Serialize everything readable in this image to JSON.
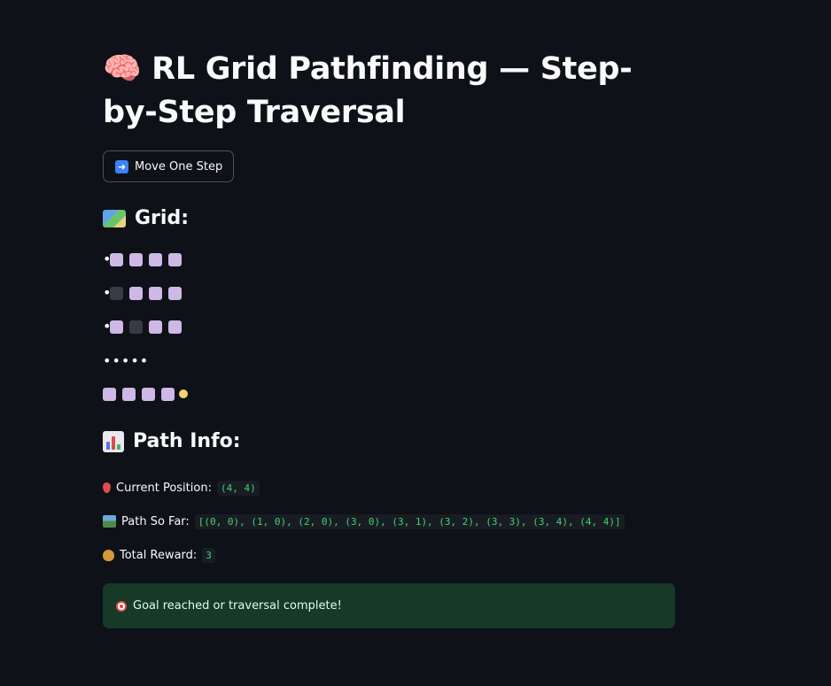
{
  "title": "🧠 RL Grid Pathfinding — Step-by-Step Traversal",
  "move_button": {
    "label": "Move One Step",
    "icon": "right-arrow-icon"
  },
  "grid_heading": {
    "icon": "map-icon",
    "text": "Grid:"
  },
  "grid": {
    "rows": [
      {
        "bullet": "•",
        "cells": [
          "open",
          "open",
          "open",
          "open"
        ]
      },
      {
        "bullet": "•",
        "cells": [
          "wall",
          "open",
          "open",
          "open"
        ]
      },
      {
        "bullet": "•",
        "cells": [
          "open",
          "wall",
          "open",
          "open"
        ]
      },
      {
        "bullet": "",
        "text": "•••••",
        "cells": []
      },
      {
        "bullet": "",
        "cells": [
          "open",
          "open",
          "open",
          "open",
          "agent"
        ]
      }
    ],
    "colors": {
      "open": "#cdb8e6",
      "wall": "#3a3a44",
      "agent": "#f3d46b"
    }
  },
  "path_heading": {
    "icon": "bar-chart-icon",
    "text": "Path Info:"
  },
  "info": {
    "current_position": {
      "label": "Current Position:",
      "value": "(4, 4)"
    },
    "path_so_far": {
      "label": "Path So Far:",
      "value": "[(0, 0), (1, 0), (2, 0), (3, 0), (3, 1), (3, 2), (3, 3), (3, 4), (4, 4)]"
    },
    "total_reward": {
      "label": "Total Reward:",
      "value": "3"
    }
  },
  "success_alert": {
    "text": "Goal reached or traversal complete!",
    "color": "#173928"
  }
}
